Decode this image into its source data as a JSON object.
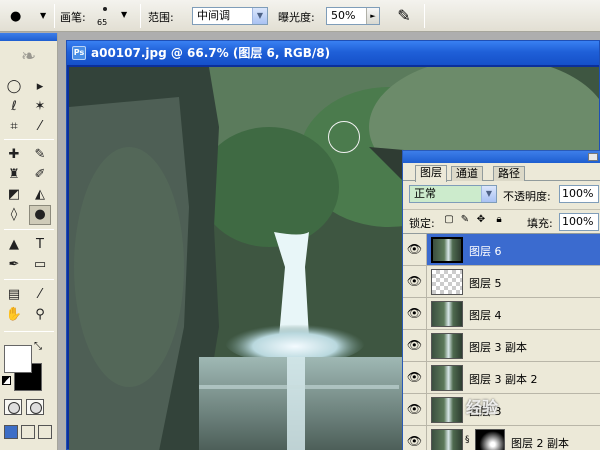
{
  "options_bar": {
    "brush_label": "画笔:",
    "brush_size": "65",
    "range_label": "范围:",
    "range_value": "中间调",
    "exposure_label": "曝光度:",
    "exposure_value": "50%"
  },
  "document": {
    "title": "a00107.jpg @ 66.7% (图层 6, RGB/8)"
  },
  "layers_panel": {
    "tabs": [
      "图层",
      "通道",
      "路径"
    ],
    "blend_mode": "正常",
    "opacity_label": "不透明度:",
    "opacity_value": "100%",
    "lock_label": "锁定:",
    "fill_label": "填充:",
    "fill_value": "100%",
    "layers": [
      {
        "name": "图层 6",
        "selected": true
      },
      {
        "name": "图层 5",
        "selected": false
      },
      {
        "name": "图层 4",
        "selected": false
      },
      {
        "name": "图层 3 副本",
        "selected": false
      },
      {
        "name": "图层 3 副本 2",
        "selected": false
      },
      {
        "name": "图层 3",
        "selected": false
      },
      {
        "name": "图层 2 副本",
        "selected": false
      }
    ]
  },
  "watermark": "经验"
}
